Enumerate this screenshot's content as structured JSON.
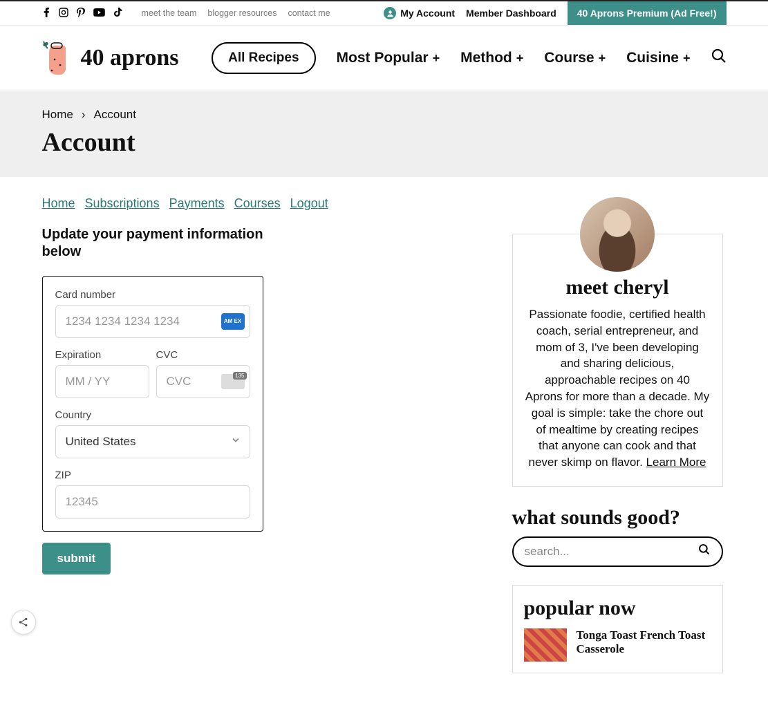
{
  "topbar": {
    "social": [
      "facebook",
      "instagram",
      "pinterest",
      "youtube",
      "tiktok"
    ],
    "links": [
      "meet the team",
      "blogger resources",
      "contact me"
    ],
    "my_account": "My Account",
    "member_dashboard": "Member Dashboard",
    "premium": "40 Aprons Premium (Ad Free!)"
  },
  "brand": {
    "name": "40 aprons"
  },
  "nav": {
    "all_recipes": "All Recipes",
    "items": [
      "Most Popular",
      "Method",
      "Course",
      "Cuisine"
    ]
  },
  "breadcrumb": {
    "home": "Home",
    "current": "Account"
  },
  "page_title": "Account",
  "account_nav": [
    "Home",
    "Subscriptions",
    "Payments",
    "Courses ",
    "Logout"
  ],
  "update_heading": "Update your payment information below",
  "form": {
    "card_label": "Card number",
    "card_placeholder": "1234 1234 1234 1234",
    "card_brand": "AM EX",
    "exp_label": "Expiration",
    "exp_placeholder": "MM / YY",
    "cvc_label": "CVC",
    "cvc_placeholder": "CVC",
    "country_label": "Country",
    "country_value": "United States",
    "zip_label": "ZIP",
    "zip_placeholder": "12345",
    "submit": "submit"
  },
  "sidebar": {
    "bio_title": "meet cheryl",
    "bio_text": "Passionate foodie, certified health coach, serial entrepreneur, and mom of 3, I've been developing and sharing delicious, approachable recipes on 40 Aprons for more than a decade. My goal is simple: take the chore out of mealtime by creating recipes that anyone can cook and that never skimp on flavor.   ",
    "learn_more": "Learn More",
    "sounds_good": "what sounds good?",
    "search_placeholder": "search...",
    "popular_heading": "popular now",
    "popular_item": "Tonga Toast French Toast Casserole"
  }
}
